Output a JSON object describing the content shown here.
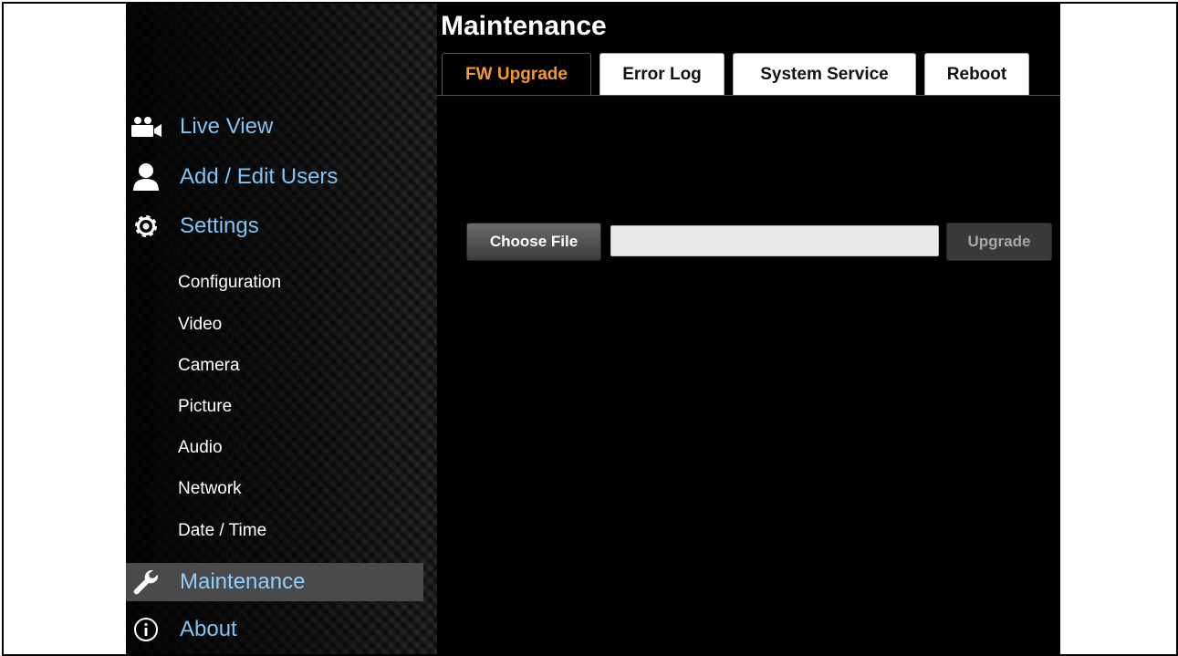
{
  "page": {
    "title": "Maintenance"
  },
  "tabs": [
    {
      "label": "FW Upgrade",
      "active": true
    },
    {
      "label": "Error Log",
      "active": false
    },
    {
      "label": "System Service",
      "active": false
    },
    {
      "label": "Reboot",
      "active": false
    }
  ],
  "sidebar": {
    "items": [
      {
        "label": "Live View",
        "icon": "video-camera-icon"
      },
      {
        "label": "Add / Edit Users",
        "icon": "user-icon"
      },
      {
        "label": "Settings",
        "icon": "gear-icon"
      },
      {
        "label": "Maintenance",
        "icon": "wrench-icon",
        "active": true
      },
      {
        "label": "About",
        "icon": "info-icon"
      }
    ],
    "sub_items": [
      {
        "label": "Configuration"
      },
      {
        "label": "Video"
      },
      {
        "label": "Camera"
      },
      {
        "label": "Picture"
      },
      {
        "label": "Audio"
      },
      {
        "label": "Network"
      },
      {
        "label": "Date / Time"
      }
    ]
  },
  "upgrade_form": {
    "choose_label": "Choose File",
    "file_value": "",
    "upgrade_label": "Upgrade"
  },
  "colors": {
    "link": "#7fc4f4",
    "active_tab_text": "#f39a2b",
    "active_nav_bg": "#4a4a4a"
  }
}
